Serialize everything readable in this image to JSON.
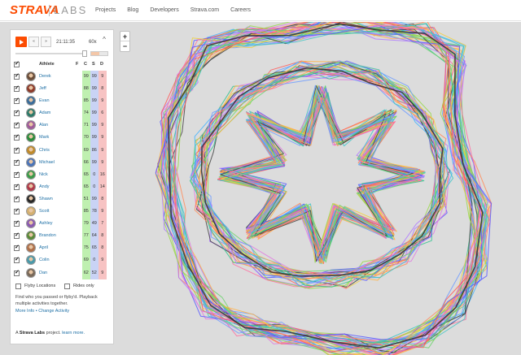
{
  "brand": {
    "logo": "STRAVA",
    "sub": "LABS",
    "color": "#fc4c02"
  },
  "nav": [
    "Projects",
    "Blog",
    "Developers",
    "Strava.com",
    "Careers"
  ],
  "zoom": {
    "in": "+",
    "out": "−"
  },
  "player": {
    "slow_label": "«",
    "fast_label": "»",
    "time": "21:11:35",
    "speed": "60x",
    "collapse_label": "^",
    "progress": 0.73
  },
  "table": {
    "headers": {
      "athlete": "Athlete",
      "f": "F",
      "c": "C",
      "s": "S",
      "d": "D"
    },
    "rows": [
      {
        "name": "Derek",
        "f": "",
        "c": "99",
        "s": "99",
        "d": "9",
        "avatar": "#6b4e3a"
      },
      {
        "name": "Jeff",
        "f": "",
        "c": "88",
        "s": "99",
        "d": "8",
        "avatar": "#8f3b2a"
      },
      {
        "name": "Evan",
        "f": "",
        "c": "85",
        "s": "99",
        "d": "9",
        "avatar": "#3b6d9a"
      },
      {
        "name": "Adam",
        "f": "",
        "c": "74",
        "s": "99",
        "d": "6",
        "avatar": "#2e7a6a"
      },
      {
        "name": "Alan",
        "f": "",
        "c": "71",
        "s": "99",
        "d": "9",
        "avatar": "#a05c9a"
      },
      {
        "name": "Mark",
        "f": "",
        "c": "70",
        "s": "99",
        "d": "9",
        "avatar": "#2c8c3c"
      },
      {
        "name": "Chris",
        "f": "",
        "c": "69",
        "s": "86",
        "d": "9",
        "avatar": "#c08a2a"
      },
      {
        "name": "Michael",
        "f": "",
        "c": "66",
        "s": "99",
        "d": "9",
        "avatar": "#4a74b8"
      },
      {
        "name": "Nick",
        "f": "",
        "c": "65",
        "s": "0",
        "d": "16",
        "avatar": "#3c9a4a"
      },
      {
        "name": "Andy",
        "f": "",
        "c": "65",
        "s": "0",
        "d": "14",
        "avatar": "#b03a4a"
      },
      {
        "name": "Shawn",
        "f": "",
        "c": "51",
        "s": "99",
        "d": "8",
        "avatar": "#2a2a2a"
      },
      {
        "name": "Scott",
        "f": "",
        "c": "85",
        "s": "78",
        "d": "9",
        "avatar": "#d4b070"
      },
      {
        "name": "Ashley",
        "f": "",
        "c": "79",
        "s": "49",
        "d": "7",
        "avatar": "#8a5ab0"
      },
      {
        "name": "Brandon",
        "f": "",
        "c": "77",
        "s": "64",
        "d": "8",
        "avatar": "#5a8a3a"
      },
      {
        "name": "April",
        "f": "",
        "c": "75",
        "s": "65",
        "d": "8",
        "avatar": "#b0704a"
      },
      {
        "name": "Colin",
        "f": "",
        "c": "69",
        "s": "0",
        "d": "9",
        "avatar": "#4a9aaa"
      },
      {
        "name": "Dan",
        "f": "",
        "c": "62",
        "s": "52",
        "d": "9",
        "avatar": "#7a6a5a"
      }
    ]
  },
  "options": {
    "flyby_locations": "Flyby Locations",
    "rides_only": "Rides only"
  },
  "description": "Find who you passed or flyby'd. Playback multiple activities together.",
  "links": {
    "more_info": "More Info",
    "separator": " • ",
    "change_activity": "Change Activity"
  },
  "footer": {
    "prefix": "A ",
    "project": "Strava Labs",
    "middle": " project. ",
    "learn_more": "learn more."
  },
  "colors": {
    "cell_c": "#bff0b0",
    "cell_s": "#c9d3f5",
    "cell_d": "#f7c3c3",
    "map_bg": "#dcdcdc"
  }
}
